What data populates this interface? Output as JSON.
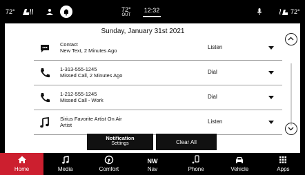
{
  "status": {
    "temp_left": "72°",
    "center_temp": "72°",
    "center_temp_sub": "OUT",
    "time": "12:32",
    "temp_right": "72°"
  },
  "panel": {
    "date": "Sunday, January 31st 2021",
    "notifications": [
      {
        "icon": "message-icon",
        "line1": "Contact",
        "line2": "New Text, 2 Minutes Ago",
        "action": "Listen"
      },
      {
        "icon": "phone-icon",
        "line1": "1-313-555-1245",
        "line2": "Missed Call, 2 Minutes Ago",
        "action": "Dial"
      },
      {
        "icon": "phone-icon",
        "line1": "1-212-555-1245",
        "line2": "Missed Call - Work",
        "action": "Dial"
      },
      {
        "icon": "music-note-icon",
        "line1": "Sirius Favorite Artist On Air",
        "line2": "Artist",
        "action": "Listen"
      }
    ],
    "buttons": {
      "notification_settings_1": "Notification",
      "notification_settings_2": "Settings",
      "clear_all": "Clear All"
    }
  },
  "nav": {
    "items": [
      {
        "label": "Home",
        "icon": "home-icon",
        "active": true
      },
      {
        "label": "Media",
        "icon": "music-note-icon"
      },
      {
        "label": "Comfort",
        "icon": "steering-wheel-icon"
      },
      {
        "label": "Nav",
        "icon": "compass-icon",
        "glyph": "NW"
      },
      {
        "label": "Phone",
        "icon": "phone-device-icon"
      },
      {
        "label": "Vehicle",
        "icon": "car-icon"
      },
      {
        "label": "Apps",
        "icon": "apps-grid-icon"
      }
    ]
  },
  "colors": {
    "accent": "#cc1f2f",
    "bar": "#000000",
    "panel": "#ffffff"
  }
}
